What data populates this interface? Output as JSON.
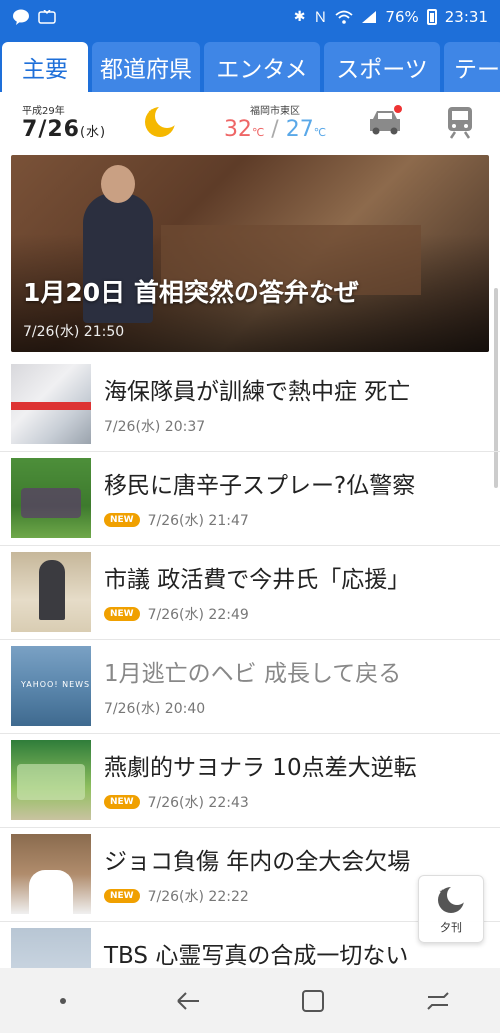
{
  "statusbar": {
    "left_icons": [
      "line-icon",
      "ktv-icon"
    ],
    "battery": "76%",
    "time": "23:31"
  },
  "tabs": [
    {
      "label": "主要",
      "active": true
    },
    {
      "label": "都道府県"
    },
    {
      "label": "エンタメ"
    },
    {
      "label": "スポーツ"
    },
    {
      "label": "テー"
    }
  ],
  "info": {
    "era": "平成29年",
    "month": "7",
    "day": "26",
    "dow": "(水)",
    "city": "福岡市東区",
    "high": "32",
    "low": "27",
    "unit": "℃",
    "weather_icon": "moon-icon",
    "accent": "#1e6fd9"
  },
  "hero": {
    "title": "1月20日 首相突然の答弁なぜ",
    "time": "7/26(水) 21:50"
  },
  "articles": [
    {
      "title": "海保隊員が訓練で熱中症 死亡",
      "time": "7/26(水) 20:37",
      "new": false
    },
    {
      "title": "移民に唐辛子スプレー?仏警察",
      "time": "7/26(水) 21:47",
      "new": true
    },
    {
      "title": "市議 政活費で今井氏「応援」",
      "time": "7/26(水) 22:49",
      "new": true
    },
    {
      "title": "1月逃亡のヘビ 成長して戻る",
      "time": "7/26(水) 20:40",
      "new": false,
      "read": true
    },
    {
      "title": "燕劇的サヨナラ 10点差大逆転",
      "time": "7/26(水) 22:43",
      "new": true
    },
    {
      "title": "ジョコ負傷 年内の全大会欠場",
      "time": "7/26(水) 22:22",
      "new": true
    },
    {
      "title": "TBS 心霊写真の合成一切ない",
      "time": "",
      "new": false
    }
  ],
  "badge_new": "NEW",
  "yukan": {
    "label": "夕刊"
  },
  "thumb_4_logo": "YAHOO! NEWS"
}
